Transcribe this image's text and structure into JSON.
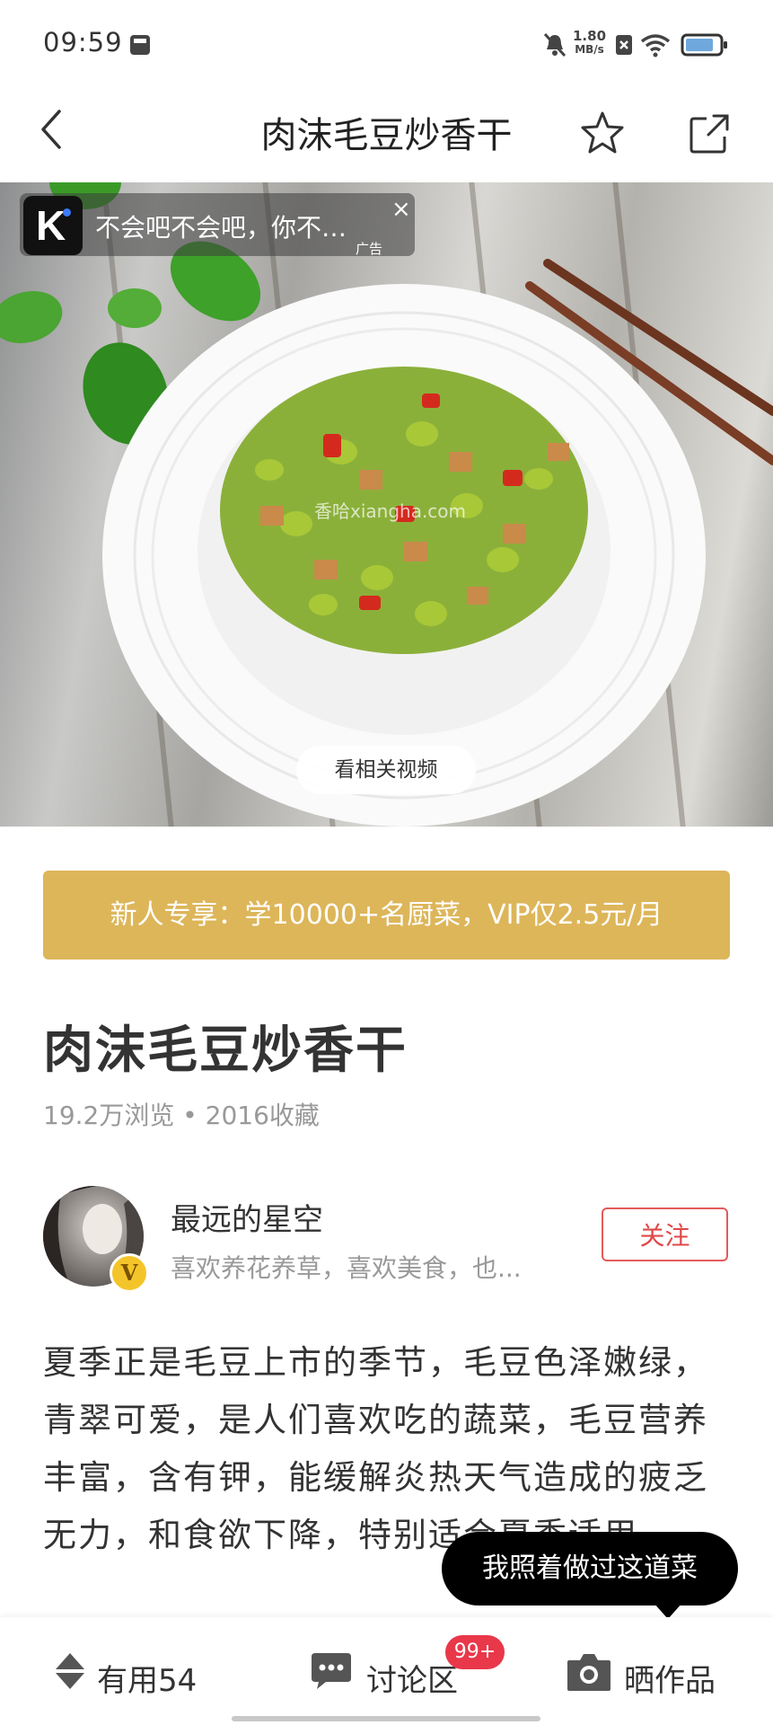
{
  "status_bar": {
    "time": "09:59",
    "net_speed_value": "1.80",
    "net_speed_unit": "MB/s"
  },
  "nav": {
    "title": "肉沫毛豆炒香干",
    "back_icon": "chevron-left-icon",
    "favorite_icon": "star-outline-icon",
    "share_icon": "share-external-icon"
  },
  "ad": {
    "text": "不会吧不会吧，你不…",
    "tag": "广告",
    "close": "×",
    "logo_letter": "K"
  },
  "hero": {
    "watermark": "香哈xiangha.com",
    "video_button": "看相关视频"
  },
  "vip_banner": "新人专享：学10000+名厨菜，VIP仅2.5元/月",
  "recipe": {
    "title": "肉沫毛豆炒香干",
    "stats": "19.2万浏览 • 2016收藏"
  },
  "author": {
    "name": "最远的星空",
    "bio": "喜欢养花养草，喜欢美食，也...",
    "badge": "V",
    "follow_label": "关注"
  },
  "description": "夏季正是毛豆上市的季节，毛豆色泽嫩绿，青翠可爱，是人们喜欢吃的蔬菜，毛豆营养丰富，含有钾，能缓解炎热天气造成的疲乏无力，和食欲下降，特别适合夏季适用。",
  "tooltip": "我照着做过这道菜",
  "bottom_bar": {
    "useful_label": "有用54",
    "discuss_label": "讨论区",
    "discuss_badge": "99+",
    "showcase_label": "晒作品"
  },
  "colors": {
    "vip_gold": "#ddb65a",
    "follow_red": "#e04848",
    "badge_red": "#e8384a"
  }
}
